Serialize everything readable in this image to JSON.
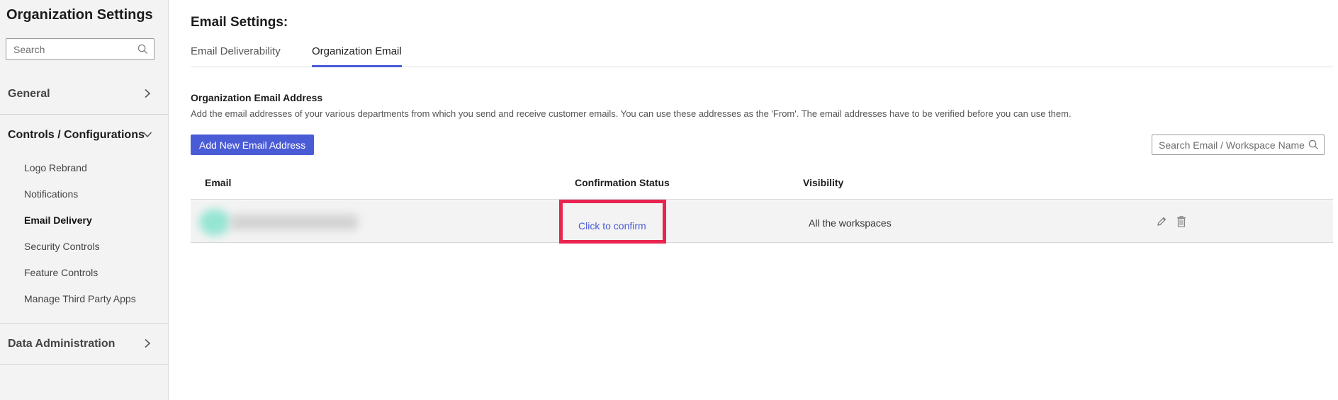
{
  "sidebar": {
    "title": "Organization Settings",
    "search_placeholder": "Search",
    "sections": [
      {
        "label": "General"
      },
      {
        "label": "Controls / Configurations"
      },
      {
        "label": "Data Administration"
      }
    ],
    "items": [
      {
        "label": "Logo Rebrand"
      },
      {
        "label": "Notifications"
      },
      {
        "label": "Email Delivery"
      },
      {
        "label": "Security Controls"
      },
      {
        "label": "Feature Controls"
      },
      {
        "label": "Manage Third Party Apps"
      }
    ]
  },
  "main": {
    "title": "Email Settings:",
    "tabs": [
      {
        "label": "Email Deliverability"
      },
      {
        "label": "Organization Email"
      }
    ],
    "section_title": "Organization Email Address",
    "section_desc": "Add the email addresses of your various departments from which you send and receive customer emails. You can use these addresses as the 'From'. The email addresses have to be verified before you can use them.",
    "add_button": "Add New Email Address",
    "search_placeholder": "Search Email / Workspace Name",
    "table": {
      "headers": [
        "Email",
        "Confirmation Status",
        "Visibility"
      ],
      "rows": [
        {
          "status": "Click to confirm",
          "visibility": "All the workspaces"
        }
      ]
    }
  },
  "colors": {
    "accent": "#4a5bd6",
    "highlight": "#e8244f",
    "sidebar_bg": "#f3f3f3"
  },
  "icons": [
    "search-icon",
    "chevron-right-icon",
    "chevron-down-icon",
    "edit-pencil-icon",
    "trash-icon"
  ]
}
